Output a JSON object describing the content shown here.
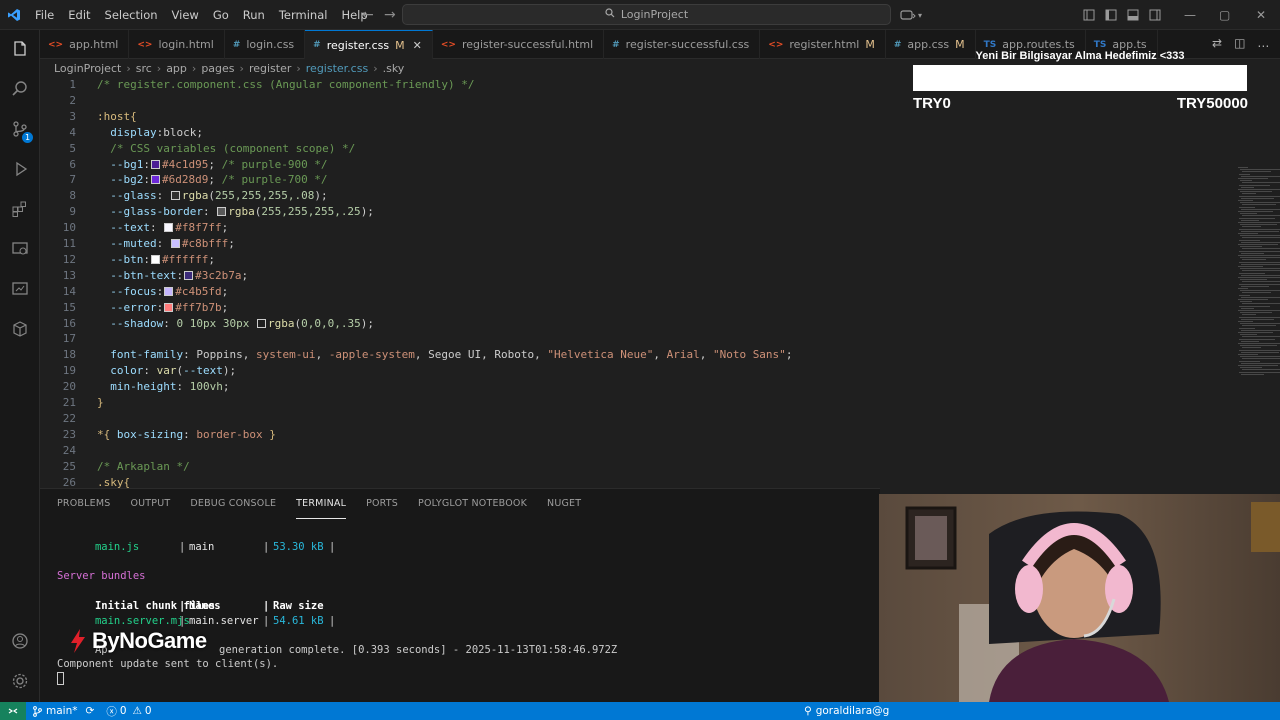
{
  "titlebar": {
    "menu": [
      "File",
      "Edit",
      "Selection",
      "View",
      "Go",
      "Run",
      "Terminal",
      "Help"
    ],
    "search_text": "LoginProject"
  },
  "tabs": [
    {
      "label": "app.html",
      "type": "html",
      "icon": "<>",
      "modified": ""
    },
    {
      "label": "login.html",
      "type": "html",
      "icon": "<>",
      "modified": ""
    },
    {
      "label": "login.css",
      "type": "css",
      "icon": "#",
      "modified": ""
    },
    {
      "label": "register.css",
      "type": "css",
      "icon": "#",
      "modified": "M",
      "active": true
    },
    {
      "label": "register-successful.html",
      "type": "html",
      "icon": "<>",
      "modified": ""
    },
    {
      "label": "register-successful.css",
      "type": "css",
      "icon": "#",
      "modified": ""
    },
    {
      "label": "register.html",
      "type": "html",
      "icon": "<>",
      "modified": "M"
    },
    {
      "label": "app.css",
      "type": "css",
      "icon": "#",
      "modified": "M"
    },
    {
      "label": "app.routes.ts",
      "type": "ts",
      "icon": "TS",
      "modified": ""
    },
    {
      "label": "app.ts",
      "type": "ts",
      "icon": "TS",
      "modified": ""
    }
  ],
  "breadcrumb": [
    "LoginProject",
    "src",
    "app",
    "pages",
    "register",
    "register.css",
    ".sky"
  ],
  "editor": {
    "lines": [
      {
        "n": "1",
        "parts": [
          [
            "/* register.component.css (Angular component-friendly) */",
            "com"
          ]
        ]
      },
      {
        "n": "2",
        "parts": []
      },
      {
        "n": "3",
        "parts": [
          [
            ":host{",
            "sel"
          ]
        ]
      },
      {
        "n": "4",
        "parts": [
          [
            "  display",
            "prop"
          ],
          [
            ":block;",
            "txt"
          ]
        ]
      },
      {
        "n": "5",
        "parts": [
          [
            "  /* CSS variables (component scope) */",
            "com"
          ]
        ]
      },
      {
        "n": "6",
        "parts": [
          [
            "  --bg1",
            "prop"
          ],
          [
            ":",
            "txt"
          ],
          [
            "#4c1d95",
            "swatch"
          ],
          [
            "#4c1d95",
            "val"
          ],
          [
            "; ",
            "txt"
          ],
          [
            "/* purple-900 */",
            "com"
          ]
        ]
      },
      {
        "n": "7",
        "parts": [
          [
            "  --bg2",
            "prop"
          ],
          [
            ":",
            "txt"
          ],
          [
            "#6d28d9",
            "swatch"
          ],
          [
            "#6d28d9",
            "val"
          ],
          [
            "; ",
            "txt"
          ],
          [
            "/* purple-700 */",
            "com"
          ]
        ]
      },
      {
        "n": "8",
        "parts": [
          [
            "  --glass",
            "prop"
          ],
          [
            ": ",
            "txt"
          ],
          [
            "#30302f",
            "swatch"
          ],
          [
            "rgba",
            "fn"
          ],
          [
            "(",
            "txt"
          ],
          [
            "255,255,255,.08",
            "num"
          ],
          [
            ");",
            "txt"
          ]
        ]
      },
      {
        "n": "9",
        "parts": [
          [
            "  --glass-border",
            "prop"
          ],
          [
            ": ",
            "txt"
          ],
          [
            "#5a5a5a",
            "swatch"
          ],
          [
            "rgba",
            "fn"
          ],
          [
            "(",
            "txt"
          ],
          [
            "255,255,255,.25",
            "num"
          ],
          [
            ");",
            "txt"
          ]
        ]
      },
      {
        "n": "10",
        "parts": [
          [
            "  --text",
            "prop"
          ],
          [
            ": ",
            "txt"
          ],
          [
            "#f8f7ff",
            "swatch"
          ],
          [
            "#f8f7ff",
            "val"
          ],
          [
            ";",
            "txt"
          ]
        ]
      },
      {
        "n": "11",
        "parts": [
          [
            "  --muted",
            "prop"
          ],
          [
            ": ",
            "txt"
          ],
          [
            "#c8bfff",
            "swatch"
          ],
          [
            "#c8bfff",
            "val"
          ],
          [
            ";",
            "txt"
          ]
        ]
      },
      {
        "n": "12",
        "parts": [
          [
            "  --btn",
            "prop"
          ],
          [
            ":",
            "txt"
          ],
          [
            "#ffffff",
            "swatch"
          ],
          [
            "#ffffff",
            "val"
          ],
          [
            ";",
            "txt"
          ]
        ]
      },
      {
        "n": "13",
        "parts": [
          [
            "  --btn-text",
            "prop"
          ],
          [
            ":",
            "txt"
          ],
          [
            "#3c2b7a",
            "swatch"
          ],
          [
            "#3c2b7a",
            "val"
          ],
          [
            ";",
            "txt"
          ]
        ]
      },
      {
        "n": "14",
        "parts": [
          [
            "  --focus",
            "prop"
          ],
          [
            ":",
            "txt"
          ],
          [
            "#c4b5fd",
            "swatch"
          ],
          [
            "#c4b5fd",
            "val"
          ],
          [
            ";",
            "txt"
          ]
        ]
      },
      {
        "n": "15",
        "parts": [
          [
            "  --error",
            "prop"
          ],
          [
            ":",
            "txt"
          ],
          [
            "#ff7b7b",
            "swatch"
          ],
          [
            "#ff7b7b",
            "val"
          ],
          [
            ";",
            "txt"
          ]
        ]
      },
      {
        "n": "16",
        "parts": [
          [
            "  --shadow",
            "prop"
          ],
          [
            ": ",
            "txt"
          ],
          [
            "0 10px 30px ",
            "num"
          ],
          [
            "#1f1f1f",
            "swatch"
          ],
          [
            "rgba",
            "fn"
          ],
          [
            "(",
            "txt"
          ],
          [
            "0,0,0,.35",
            "num"
          ],
          [
            ");",
            "txt"
          ]
        ]
      },
      {
        "n": "17",
        "parts": []
      },
      {
        "n": "18",
        "parts": [
          [
            "  font-family",
            "prop"
          ],
          [
            ": Poppins, ",
            "txt"
          ],
          [
            "system-ui",
            "val"
          ],
          [
            ", ",
            "txt"
          ],
          [
            "-apple-system",
            "val"
          ],
          [
            ", Segoe UI, Roboto, ",
            "txt"
          ],
          [
            "\"Helvetica Neue\"",
            "val"
          ],
          [
            ", ",
            "txt"
          ],
          [
            "Arial",
            "val"
          ],
          [
            ", ",
            "txt"
          ],
          [
            "\"Noto Sans\"",
            "val"
          ],
          [
            ";",
            "txt"
          ]
        ]
      },
      {
        "n": "19",
        "parts": [
          [
            "  color",
            "prop"
          ],
          [
            ": ",
            "txt"
          ],
          [
            "var",
            "fn"
          ],
          [
            "(",
            "txt"
          ],
          [
            "--text",
            "prop"
          ],
          [
            ");",
            "txt"
          ]
        ]
      },
      {
        "n": "20",
        "parts": [
          [
            "  min-height",
            "prop"
          ],
          [
            ": ",
            "txt"
          ],
          [
            "100vh",
            "num"
          ],
          [
            ";",
            "txt"
          ]
        ]
      },
      {
        "n": "21",
        "parts": [
          [
            "}",
            "sel"
          ]
        ]
      },
      {
        "n": "22",
        "parts": []
      },
      {
        "n": "23",
        "parts": [
          [
            "*{ ",
            "sel"
          ],
          [
            "box-sizing",
            "prop"
          ],
          [
            ": ",
            "txt"
          ],
          [
            "border-box",
            "val"
          ],
          [
            " }",
            "sel"
          ]
        ]
      },
      {
        "n": "24",
        "parts": []
      },
      {
        "n": "25",
        "parts": [
          [
            "/* Arkaplan */",
            "com"
          ]
        ]
      },
      {
        "n": "26",
        "parts": [
          [
            ".sky{",
            "sel"
          ]
        ]
      }
    ]
  },
  "goal": {
    "title": "Yeni Bir Bilgisayar Alma Hedefimiz <333",
    "min_label": "TRY0",
    "max_label": "TRY50000",
    "progress_fraction": 0,
    "fill_color": "#7b3fe4"
  },
  "panel": {
    "tabs": [
      "PROBLEMS",
      "OUTPUT",
      "DEBUG CONSOLE",
      "TERMINAL",
      "PORTS",
      "POLYGLOT NOTEBOOK",
      "NUGET"
    ],
    "active_tab": "TERMINAL",
    "terminal": {
      "row1": {
        "file": "main.js",
        "name": "main",
        "size": "53.30 kB"
      },
      "server_bundles": "Server bundles",
      "header": {
        "files": "Initial chunk files",
        "names": "Names",
        "size": "Raw size"
      },
      "row2": {
        "file": "main.server.mjs",
        "name": "main.server",
        "size": "54.61 kB"
      },
      "generation_prefix": "Ap",
      "generation_text": "generation complete. [0.393 seconds] - 2025-11-13T01:58:46.972Z",
      "update_text": "Component update sent to client(s)."
    }
  },
  "overlay_logo": "ByNoGame",
  "statusbar": {
    "branch": "main*",
    "errors": "0",
    "warnings": "0",
    "account": "goraldilara@g"
  }
}
